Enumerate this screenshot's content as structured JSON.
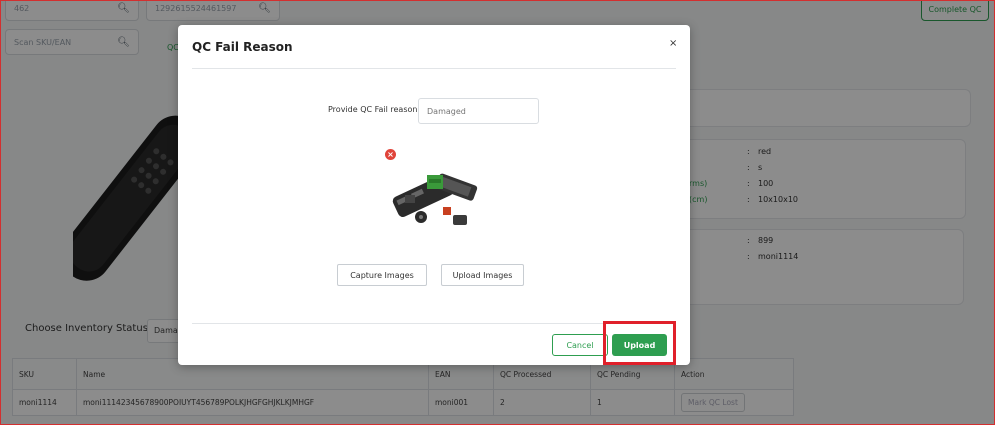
{
  "background": {
    "order_input": "462",
    "awb_input": "1292615524461597",
    "scan_input": {
      "placeholder": "Scan SKU/EAN"
    },
    "complete_qc_label": "Complete QC",
    "qc_tab_label": "QC",
    "details_partial": [
      {
        "label": "",
        "value": "red"
      },
      {
        "label": "",
        "value": "s"
      },
      {
        "label": "rms)",
        "value": "100"
      },
      {
        "label": "(cm)",
        "value": "10x10x10"
      }
    ],
    "details2_partial": [
      {
        "label": "",
        "value": "899"
      },
      {
        "label": "",
        "value": "moni1114"
      }
    ],
    "inventory_status_label": "Choose Inventory Status",
    "inventory_status_value": "Damaged",
    "table": {
      "headers": [
        "SKU",
        "Name",
        "EAN",
        "QC Processed",
        "QC Pending",
        "Action"
      ],
      "rows": [
        [
          "moni1114",
          "moni11142345678900POIUYT456789POLKJHGFGHJKLKJMHGF",
          "moni001",
          "2",
          "1",
          "Mark QC Lost"
        ]
      ]
    }
  },
  "modal": {
    "title": "QC Fail Reason",
    "close_glyph": "×",
    "reason_label": "Provide QC Fail reason :",
    "reason_placeholder": "Damaged",
    "remove_glyph": "×",
    "capture_label": "Capture Images",
    "upload_images_label": "Upload Images",
    "cancel_label": "Cancel",
    "upload_label": "Upload"
  },
  "colors": {
    "accent": "#2e9e50",
    "highlight": "#e0202a",
    "remove": "#e0443a"
  }
}
